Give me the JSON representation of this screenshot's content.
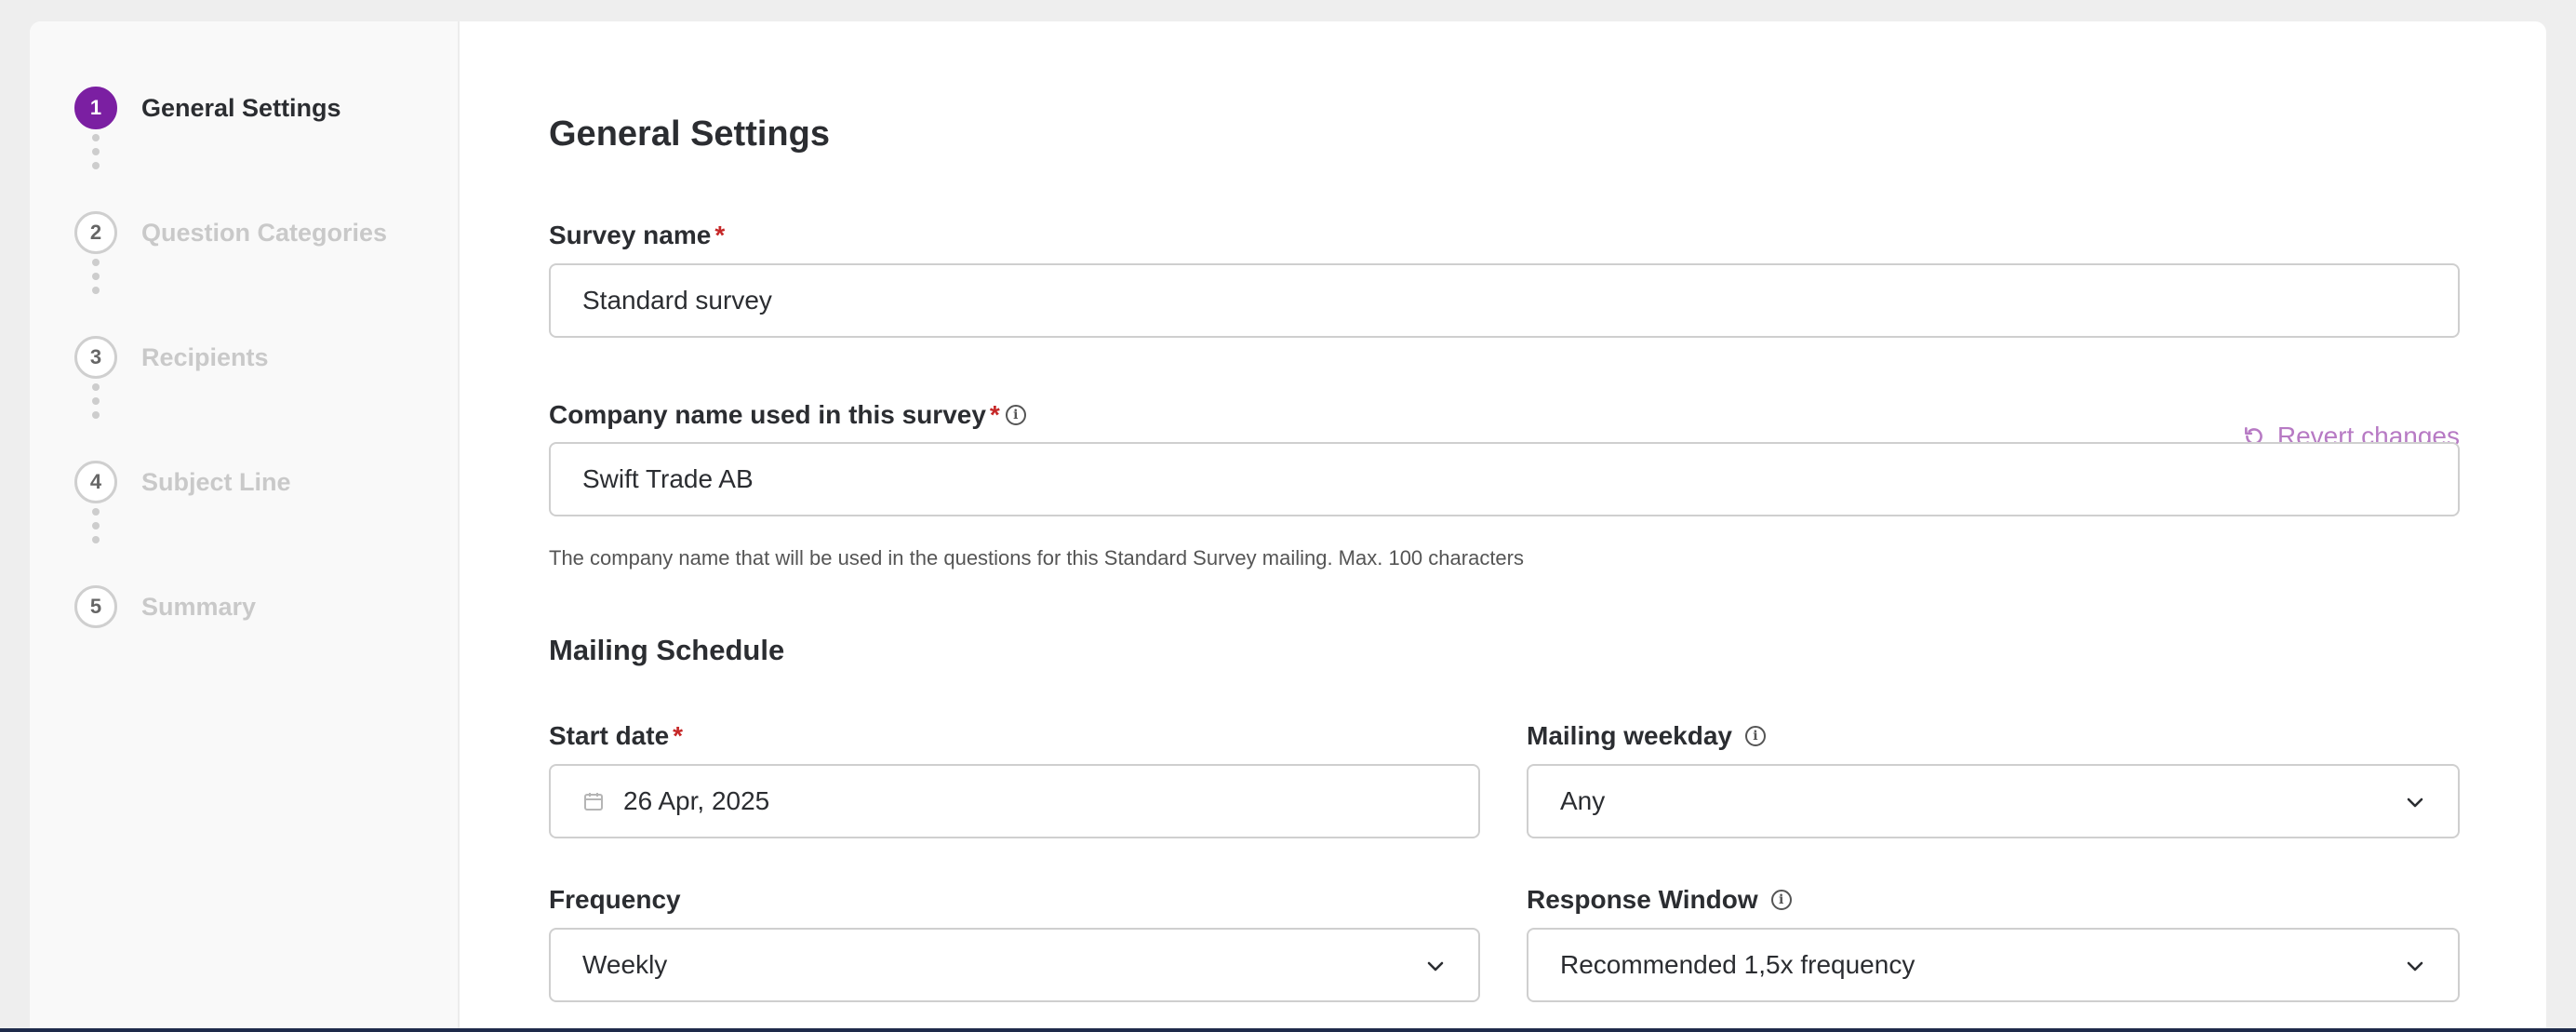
{
  "steps": [
    {
      "number": "1",
      "label": "General Settings",
      "state": "active"
    },
    {
      "number": "2",
      "label": "Question Categories",
      "state": "inactive"
    },
    {
      "number": "3",
      "label": "Recipients",
      "state": "inactive"
    },
    {
      "number": "4",
      "label": "Subject Line",
      "state": "inactive"
    },
    {
      "number": "5",
      "label": "Summary",
      "state": "inactive"
    }
  ],
  "page_title": "General Settings",
  "survey_name": {
    "label": "Survey name",
    "required_mark": "*",
    "value": "Standard survey"
  },
  "company_name": {
    "label": "Company name used in this survey",
    "required_mark": "*",
    "value": "Swift Trade AB",
    "help": "The company name that will be used in the questions for this Standard Survey mailing. Max. 100 characters",
    "revert_label": "Revert changes"
  },
  "mailing_schedule": {
    "heading": "Mailing Schedule",
    "start_date": {
      "label": "Start date",
      "required_mark": "*",
      "value": "26 Apr, 2025"
    },
    "mailing_weekday": {
      "label": "Mailing weekday",
      "value": "Any"
    },
    "frequency": {
      "label": "Frequency",
      "value": "Weekly"
    },
    "response_window": {
      "label": "Response Window",
      "value": "Recommended 1,5x frequency"
    }
  },
  "colors": {
    "accent": "#7b1fa2",
    "required": "#c62828",
    "revert": "#b77ac4"
  }
}
